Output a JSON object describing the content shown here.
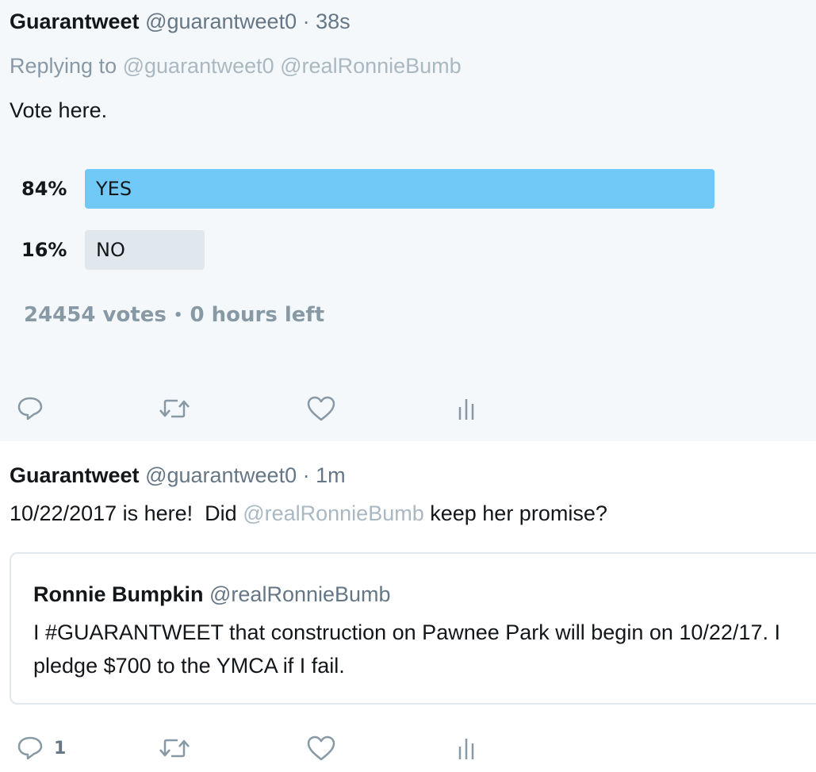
{
  "tweet1": {
    "name": "Guarantweet",
    "handle": "@guarantweet0",
    "separator": "·",
    "time": "38s",
    "replying_prefix": "Replying to",
    "replying_mentions": "@guarantweet0 @realRonnieBumb",
    "text": "Vote here.",
    "poll": {
      "options": [
        {
          "percent_label": "84%",
          "label": "YES",
          "fraction": 0.84
        },
        {
          "percent_label": "16%",
          "label": "NO",
          "fraction": 0.16
        }
      ],
      "votes": "24454 votes",
      "bullet": "•",
      "time_left": "0 hours left"
    },
    "actions": {
      "reply_icon": "reply-icon",
      "retweet_icon": "retweet-icon",
      "like_icon": "like-icon",
      "analytics_icon": "analytics-icon"
    }
  },
  "tweet2": {
    "name": "Guarantweet",
    "handle": "@guarantweet0",
    "separator": "·",
    "time": "1m",
    "text_before": "10/22/2017 is here!  Did ",
    "text_mention": "@realRonnieBumb",
    "text_after": " keep her promise?",
    "quote": {
      "name": "Ronnie Bumpkin",
      "handle": "@realRonnieBumb",
      "text": "I #GUARANTWEET that construction on Pawnee Park will begin on 10/22/17. I pledge $700 to the YMCA if I fail."
    },
    "actions": {
      "reply_count": "1"
    }
  },
  "colors": {
    "poll_winner": "#71c9f8",
    "poll_loser": "#e1e8ed",
    "background_top": "#f5f8fa",
    "muted_text": "#657786",
    "mention_text": "#aab8c2"
  }
}
